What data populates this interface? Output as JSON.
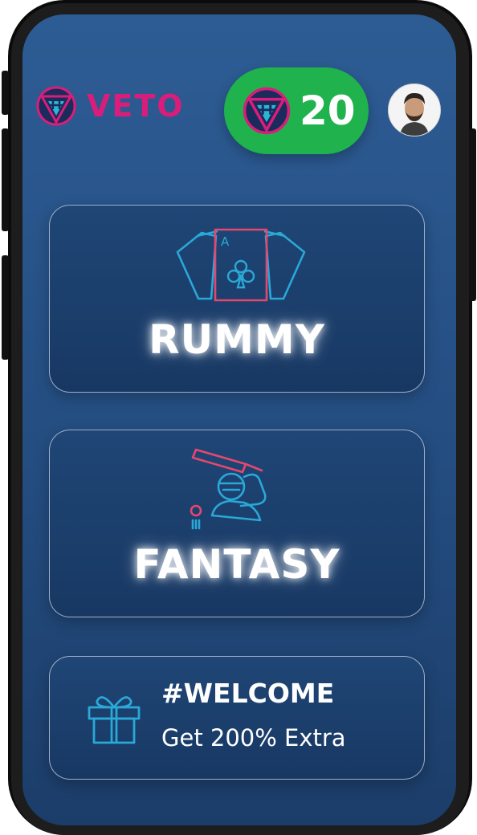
{
  "brand": {
    "name": "VETO",
    "logo_icon": "veto-shield-icon",
    "accent": "#d81e7a"
  },
  "wallet": {
    "coins": "20",
    "icon": "veto-coin-icon",
    "pill_color": "#20b24c"
  },
  "profile": {
    "avatar_icon": "user-avatar"
  },
  "games": [
    {
      "label": "RUMMY",
      "icon": "playing-cards-icon"
    },
    {
      "label": "FANTASY",
      "icon": "cricket-batsman-icon"
    }
  ],
  "promo": {
    "title": "#WELCOME",
    "subtitle": "Get 200% Extra",
    "icon": "gift-icon"
  }
}
